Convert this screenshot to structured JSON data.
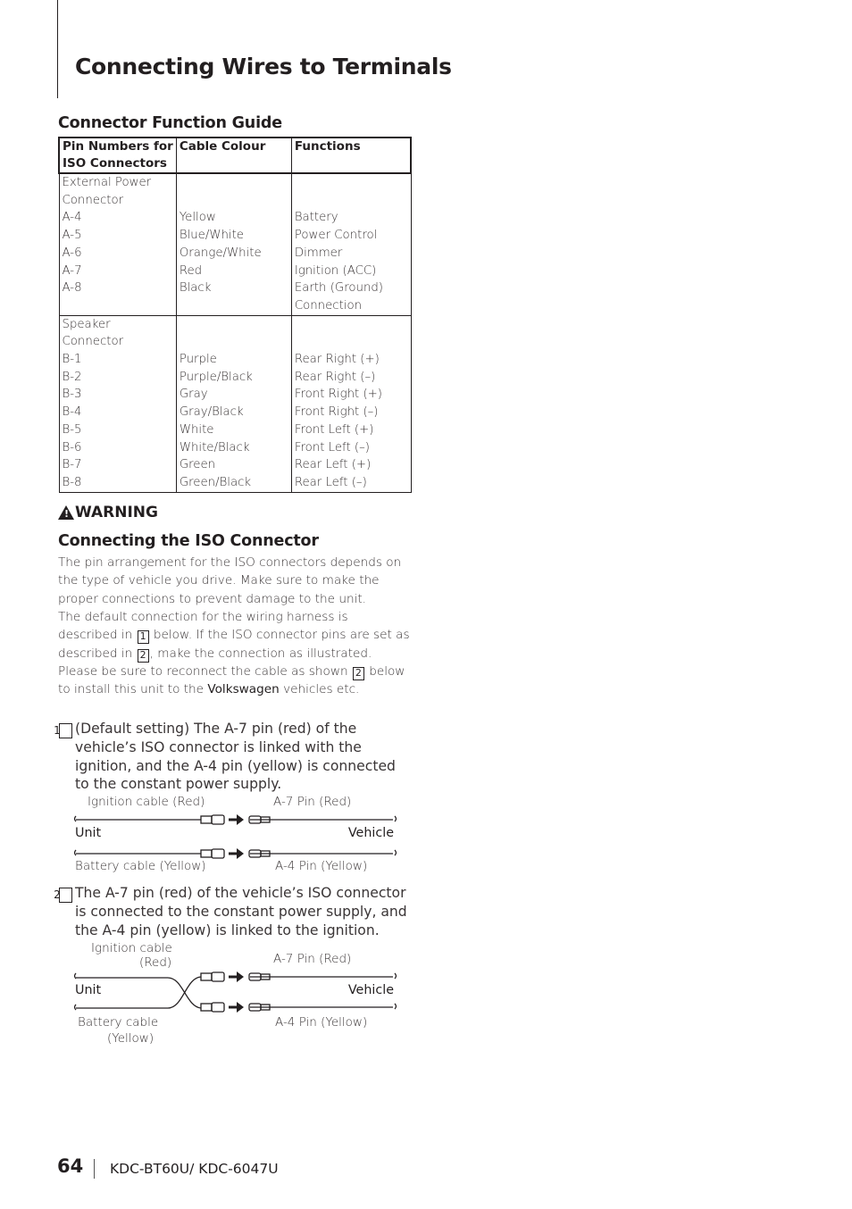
{
  "page": {
    "title": "Connecting Wires to Terminals",
    "page_number": "64",
    "model": "KDC-BT60U/ KDC-6047U"
  },
  "guide": {
    "heading": "Connector Function Guide",
    "headers": {
      "pin_line1": "Pin Numbers for",
      "pin_line2": "ISO Connectors",
      "colour": "Cable Colour",
      "functions": "Functions"
    },
    "groups": [
      {
        "name_line1": "External Power",
        "name_line2": "Connector",
        "rows": [
          {
            "pin": "A-4",
            "colour": "Yellow",
            "function": "Battery"
          },
          {
            "pin": "A-5",
            "colour": "Blue/White",
            "function": "Power Control"
          },
          {
            "pin": "A-6",
            "colour": "Orange/White",
            "function": "Dimmer"
          },
          {
            "pin": "A-7",
            "colour": "Red",
            "function": "Ignition (ACC)"
          },
          {
            "pin": "A-8",
            "colour": "Black",
            "function": "Earth (Ground)"
          }
        ],
        "extra_function": "Connection"
      },
      {
        "name_line1": "Speaker",
        "name_line2": "Connector",
        "rows": [
          {
            "pin": "B-1",
            "colour": "Purple",
            "function": "Rear Right (+)"
          },
          {
            "pin": "B-2",
            "colour": "Purple/Black",
            "function": "Rear Right (–)"
          },
          {
            "pin": "B-3",
            "colour": "Gray",
            "function": "Front Right (+)"
          },
          {
            "pin": "B-4",
            "colour": "Gray/Black",
            "function": "Front Right (–)"
          },
          {
            "pin": "B-5",
            "colour": "White",
            "function": "Front Left (+)"
          },
          {
            "pin": "B-6",
            "colour": "White/Black",
            "function": "Front Left (–)"
          },
          {
            "pin": "B-7",
            "colour": "Green",
            "function": "Rear Left (+)"
          },
          {
            "pin": "B-8",
            "colour": "Green/Black",
            "function": "Rear Left (–)"
          }
        ]
      }
    ]
  },
  "warning": {
    "icon": "warning-triangle-icon",
    "label": "WARNING",
    "heading": "Connecting the ISO Connector",
    "p1": "The pin arrangement for the ISO connectors depends on the type of vehicle you drive. Make sure to make the proper connections to prevent damage to the unit.",
    "p2_a": "The default connection for the wiring harness is described in",
    "p2_b": "below. If the ISO connector pins are set as described in",
    "p2_c": ", make the connection as illustrated.",
    "p3_a": "Please be sure to reconnect the cable as shown",
    "p3_b": "below to install this unit to the",
    "p3_brand": "Volkswagen",
    "p3_c": "vehicles etc.",
    "ref1": "1",
    "ref2": "2"
  },
  "case1": {
    "num": "1",
    "text": "(Default setting) The A-7 pin (red) of the vehicle’s ISO connector is linked with the ignition, and the A-4 pin (yellow) is connected to the constant power supply.",
    "top_left": "Ignition cable (Red)",
    "top_right": "A-7 Pin (Red)",
    "unit": "Unit",
    "vehicle": "Vehicle",
    "bottom_left": "Battery cable (Yellow)",
    "bottom_right": "A-4 Pin (Yellow)"
  },
  "case2": {
    "num": "2",
    "text": "The A-7 pin (red) of the vehicle’s ISO connector is connected to the constant power supply, and the A-4 pin (yellow) is linked to the ignition.",
    "top_left_1": "Ignition cable",
    "top_left_2": "(Red)",
    "top_right": "A-7 Pin (Red)",
    "unit": "Unit",
    "vehicle": "Vehicle",
    "bottom_left_1": "Battery cable",
    "bottom_left_2": "(Yellow)",
    "bottom_right": "A-4 Pin (Yellow)"
  }
}
